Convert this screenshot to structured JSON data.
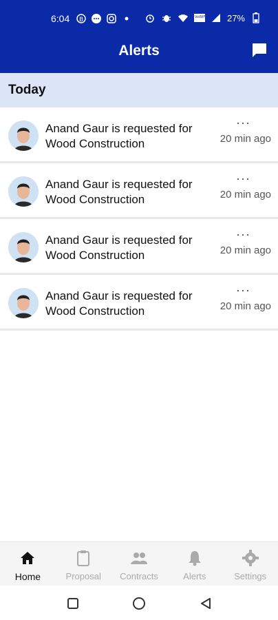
{
  "status_bar": {
    "time": "6:04",
    "battery": "27%",
    "icons_left": [
      "b-icon",
      "messages-icon",
      "instagram-icon",
      "dot-icon"
    ],
    "icons_right": [
      "alarm-icon",
      "bug-icon",
      "wifi-icon",
      "vowifi-icon",
      "signal-icon",
      "battery-icon"
    ]
  },
  "header": {
    "title": "Alerts"
  },
  "section": {
    "title": "Today"
  },
  "alerts": [
    {
      "text": "Anand Gaur is requested for Wood Construction",
      "time": "20 min ago",
      "menu": "···"
    },
    {
      "text": "Anand Gaur is requested for Wood Construction",
      "time": "20 min ago",
      "menu": "···"
    },
    {
      "text": "Anand Gaur is requested for Wood Construction",
      "time": "20 min ago",
      "menu": "···"
    },
    {
      "text": "Anand Gaur is requested for Wood Construction",
      "time": "20 min ago",
      "menu": "···"
    }
  ],
  "tabs": [
    {
      "label": "Home",
      "icon": "home-icon",
      "active": true
    },
    {
      "label": "Proposal",
      "icon": "clipboard-icon",
      "active": false
    },
    {
      "label": "Contracts",
      "icon": "people-icon",
      "active": false
    },
    {
      "label": "Alerts",
      "icon": "bell-icon",
      "active": false
    },
    {
      "label": "Settings",
      "icon": "gear-icon",
      "active": false
    }
  ],
  "colors": {
    "appbar": "#0a2aa8",
    "section_bg": "#dde6f7",
    "active_tab": "#111111",
    "inactive_tab": "#aaaaaa"
  }
}
